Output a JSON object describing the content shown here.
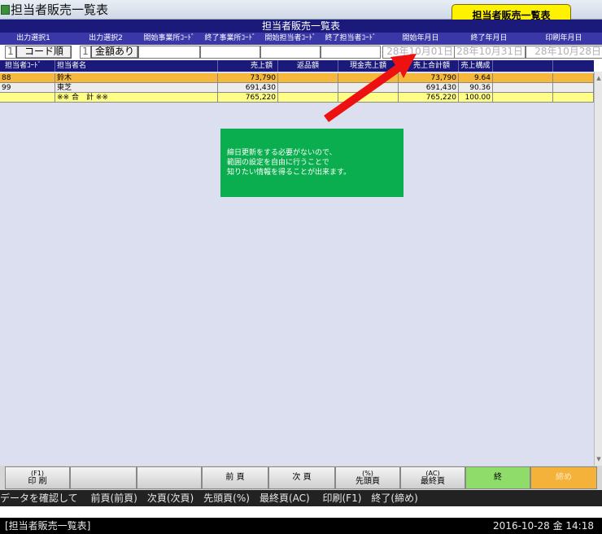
{
  "window": {
    "title": "担当者販売一覧表"
  },
  "screen_title": "担当者販売一覧表",
  "callout": "担当者販売一覧表",
  "params": {
    "headers": [
      "出力選択1",
      "出力選択2",
      "開始事業所ｺｰﾄﾞ",
      "終了事業所ｺｰﾄﾞ",
      "開始担当者ｺｰﾄﾞ",
      "終了担当者ｺｰﾄﾞ",
      "開始年月日",
      "終了年月日",
      "印刷年月日"
    ],
    "select1": {
      "num": "1",
      "label": "コード順"
    },
    "select2": {
      "num": "1",
      "label": "金額あり"
    },
    "start_date": "28年10月01日",
    "end_date": "28年10月31日",
    "print_date": "28年10月28日"
  },
  "table": {
    "columns": [
      "担当者ｺｰﾄﾞ",
      "担当者名",
      "売上額",
      "返品額",
      "現金売上額",
      "売上合計額",
      "売上構成"
    ],
    "rows": [
      {
        "code": "88",
        "name": "鈴木",
        "sales": "73,790",
        "returns": "",
        "cash": "",
        "total": "73,790",
        "ratio": "9.64"
      },
      {
        "code": "99",
        "name": "東芝",
        "sales": "691,430",
        "returns": "",
        "cash": "",
        "total": "691,430",
        "ratio": "90.36"
      },
      {
        "code": "",
        "name": "※※ 合　計 ※※",
        "sales": "765,220",
        "returns": "",
        "cash": "",
        "total": "765,220",
        "ratio": "100.00"
      }
    ]
  },
  "note": [
    "締日更新をする必要がないので、",
    "範囲の設定を自由に行うことで",
    "知りたい情報を得ることが出来ます。"
  ],
  "fkeys": {
    "print": {
      "top": "(F1)",
      "label": "印 刷"
    },
    "prev": "前 頁",
    "next": "次 頁",
    "first": {
      "top": "(%)",
      "label": "先頭頁"
    },
    "last": {
      "top": "(AC)",
      "label": "最終頁"
    },
    "end": "終",
    "close": "締め"
  },
  "guide_text": "データを確認して　 前頁(前頁)　次頁(次頁)　先頭頁(%)　最終頁(AC)　 印刷(F1)　終了(締め)",
  "status": {
    "left": "[担当者販売一覧表]",
    "right": "2016-10-28 金 14:18"
  },
  "colors": {
    "row_selected": "#f6b83a",
    "row_normal": "#ececec",
    "row_total": "#ffff88",
    "header_navy": "#1b1a7a",
    "note_green": "#0aae4e",
    "callout_yellow": "#fff200",
    "arrow_red": "#ee1111"
  }
}
